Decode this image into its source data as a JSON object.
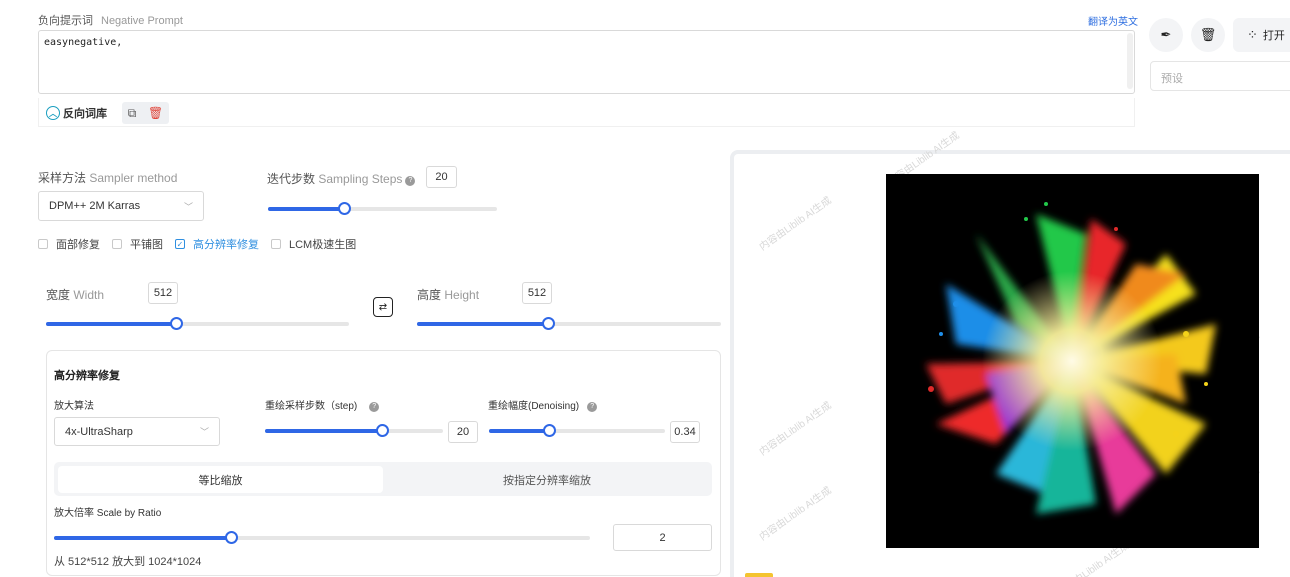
{
  "negative_prompt": {
    "title_cn": "负向提示词",
    "title_en": "Negative Prompt",
    "translate_link": "翻译为英文",
    "value": "easynegative,",
    "library_label": "反向词库"
  },
  "right_top": {
    "open_label": "打开",
    "preset_placeholder": "预设"
  },
  "sampler": {
    "label_cn": "采样方法",
    "label_en": "Sampler method",
    "value": "DPM++ 2M Karras"
  },
  "steps": {
    "label_cn": "迭代步数",
    "label_en": "Sampling Steps",
    "value": "20",
    "fraction": 0.33
  },
  "checkboxes": [
    {
      "label": "面部修复",
      "checked": false
    },
    {
      "label": "平铺图",
      "checked": false
    },
    {
      "label": "高分辨率修复",
      "checked": true
    },
    {
      "label": "LCM极速生图",
      "checked": false
    }
  ],
  "width": {
    "label_cn": "宽度",
    "label_en": "Width",
    "value": "512",
    "fraction": 0.43
  },
  "height": {
    "label_cn": "高度",
    "label_en": "Height",
    "value": "512",
    "fraction": 0.43
  },
  "hires": {
    "title": "高分辨率修复",
    "upscaler_label": "放大算法",
    "upscaler_value": "4x-UltraSharp",
    "steps_label": "重绘采样步数（step)",
    "steps_value": "20",
    "steps_fraction": 0.66,
    "denoise_label": "重绘幅度(Denoising)",
    "denoise_value": "0.34",
    "denoise_fraction": 0.34,
    "mode_ratio": "等比缩放",
    "mode_resolution": "按指定分辨率缩放",
    "scale_label": "放大倍率 Scale by Ratio",
    "scale_value": "2",
    "scale_fraction": 0.33,
    "scale_summary": "从 512*512 放大到 1024*1024"
  },
  "preview": {
    "watermark": "内容由Liblib AI生成"
  },
  "colors": {
    "accent": "#2f67e6",
    "link": "#2f6fe0",
    "checked": "#2f8fe0"
  }
}
